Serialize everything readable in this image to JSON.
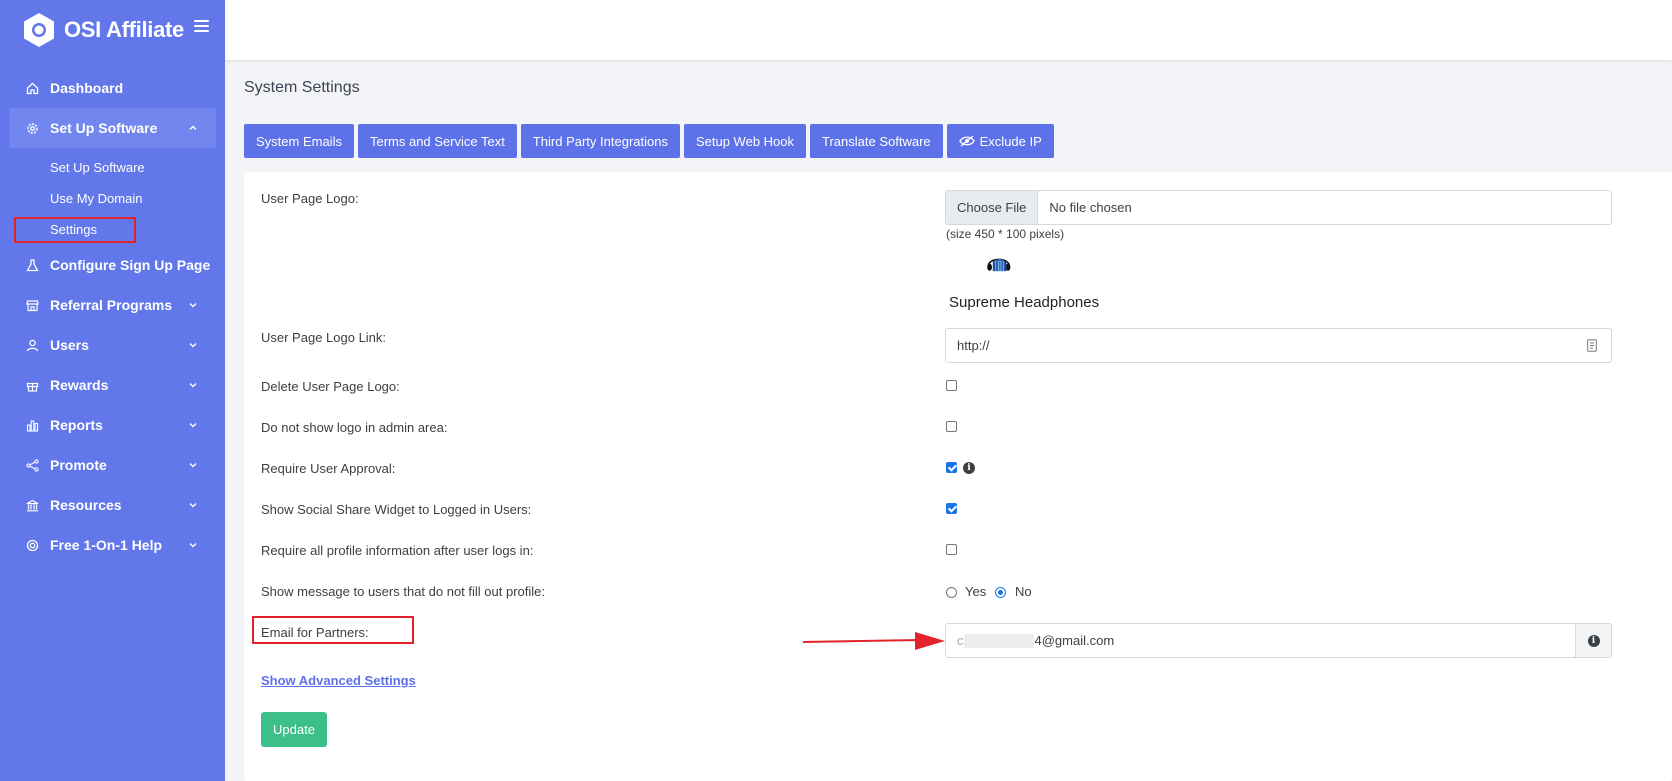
{
  "brand": {
    "name": "OSI Affiliate"
  },
  "sidebar": {
    "items": [
      {
        "label": "Dashboard",
        "icon": "home-icon"
      },
      {
        "label": "Set Up Software",
        "icon": "gear-icon",
        "expanded": true
      },
      {
        "label": "Configure Sign Up Page",
        "icon": "flask-icon"
      },
      {
        "label": "Referral Programs",
        "icon": "store-icon"
      },
      {
        "label": "Users",
        "icon": "user-icon"
      },
      {
        "label": "Rewards",
        "icon": "gift-icon"
      },
      {
        "label": "Reports",
        "icon": "bar-chart-icon"
      },
      {
        "label": "Promote",
        "icon": "share-icon"
      },
      {
        "label": "Resources",
        "icon": "bank-icon"
      },
      {
        "label": "Free 1-On-1 Help",
        "icon": "lifebuoy-icon"
      }
    ],
    "subitems": [
      "Set Up Software",
      "Use My Domain",
      "Settings"
    ]
  },
  "page": {
    "title": "System Settings"
  },
  "tabs": [
    "System Emails",
    "Terms and Service Text",
    "Third Party Integrations",
    "Setup Web Hook",
    "Translate Software",
    "Exclude IP"
  ],
  "form": {
    "logo_label": "User Page Logo:",
    "choose_file": "Choose File",
    "no_file": "No file chosen",
    "size_hint": "(size 450 * 100 pixels)",
    "logo_preview_text": "Supreme Headphones",
    "logo_link_label": "User Page Logo Link:",
    "logo_link_value": "http://",
    "delete_logo_label": "Delete User Page Logo:",
    "no_admin_logo_label": "Do not show logo in admin area:",
    "require_approval_label": "Require User Approval:",
    "social_widget_label": "Show Social Share Widget to Logged in Users:",
    "require_profile_label": "Require all profile information after user logs in:",
    "show_message_label": "Show message to users that do not fill out profile:",
    "yes_label": "Yes",
    "no_label": "No",
    "email_label": "Email for Partners:",
    "email_value_prefix": "c",
    "email_value_suffix": "4@gmail.com",
    "advanced_link": "Show Advanced Settings",
    "update_button": "Update"
  },
  "colors": {
    "sidebar": "#6177ea",
    "tab": "#5d71e9",
    "update": "#3dbf8a",
    "highlight": "#e2232b"
  }
}
